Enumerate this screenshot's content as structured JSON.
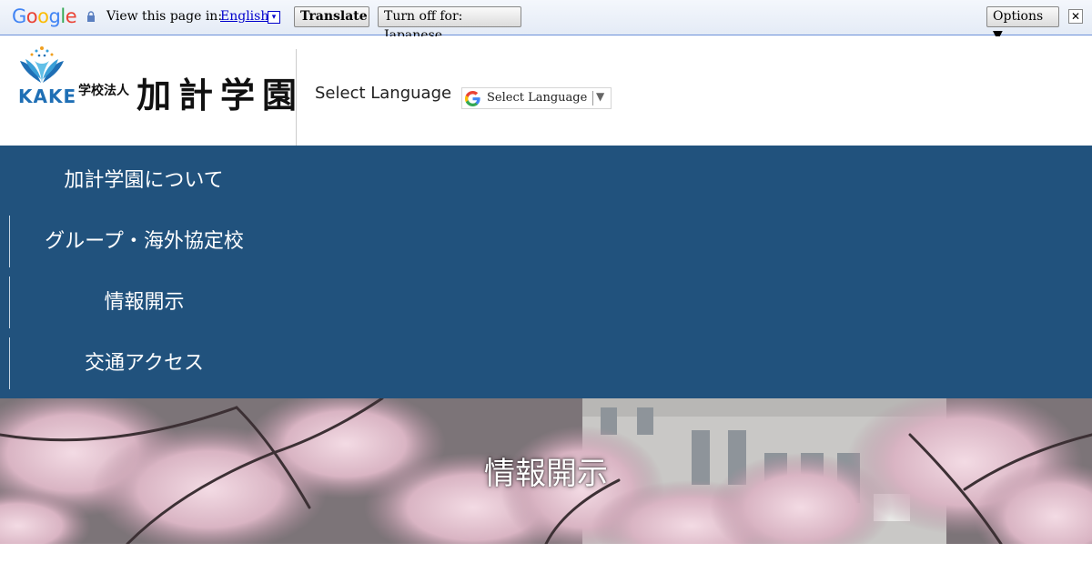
{
  "translate_bar": {
    "brand": "Google",
    "view_text": "View this page in:",
    "language": "English",
    "translate_label": "Translate",
    "turn_off_label": "Turn off for: Japanese",
    "options_label": "Options ▼",
    "close_label": "✕",
    "dropdown_glyph": "▾"
  },
  "header": {
    "logo_letters": "KAKE",
    "school_type": "学校法人",
    "school_name": "加計学園",
    "select_language_label": "Select Language",
    "language_dropdown": {
      "value": "Select Language",
      "arrow": "▼"
    }
  },
  "nav": {
    "items": [
      {
        "label": "加計学園について"
      },
      {
        "label": "グループ・海外協定校"
      },
      {
        "label": "情報開示"
      },
      {
        "label": "交通アクセス"
      }
    ]
  },
  "hero": {
    "title": "情報開示"
  },
  "colors": {
    "nav_background": "#21527d",
    "logo_blue": "#1f6fb5",
    "link_blue": "#0000cc"
  }
}
